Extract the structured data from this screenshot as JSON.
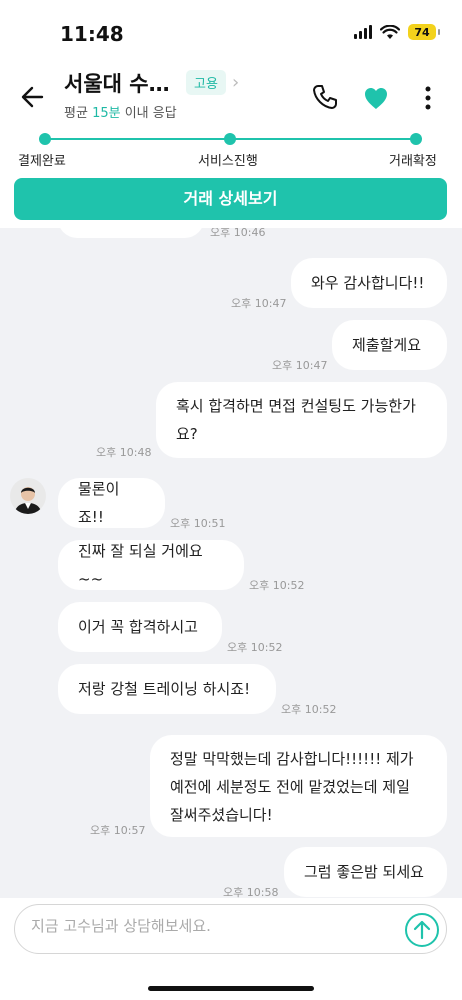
{
  "status_bar": {
    "time": "11:48",
    "battery": "74"
  },
  "header": {
    "title": "서울대 수…",
    "tag": "고용",
    "subtitle_prefix": "평균 ",
    "subtitle_highlight": "15분",
    "subtitle_suffix": " 이내 응답"
  },
  "progress": {
    "steps": [
      "결제완료",
      "서비스진행",
      "거래확정"
    ]
  },
  "detail_button": "거래 상세보기",
  "messages": [
    {
      "side": "right",
      "text": "와우 감사합니다!!",
      "time": "오후 10:47"
    },
    {
      "side": "right",
      "text": "제출할게요",
      "time": "오후 10:47"
    },
    {
      "side": "right",
      "text": "혹시 합격하면 면접 컨설팅도 가능한가\n요?",
      "time": "오후 10:48"
    },
    {
      "side": "left",
      "text": "물론이죠!!",
      "time": "오후 10:51"
    },
    {
      "side": "left",
      "text": "진짜 잘 되실 거에요~~",
      "time": "오후 10:52"
    },
    {
      "side": "left",
      "text": "이거 꼭 합격하시고",
      "time": "오후 10:52"
    },
    {
      "side": "left",
      "text": "저랑 강철 트레이닝 하시죠!",
      "time": "오후 10:52"
    },
    {
      "side": "right",
      "text": "정말 막막했는데 감사합니다!!!!!! 제가\n예전에 세분정도 전에 맡겼었는데 제일\n잘써주셨습니다!",
      "time": "오후 10:57"
    },
    {
      "side": "right",
      "text": "그럼 좋은밤 되세요",
      "time": "오후 10:58"
    }
  ],
  "partial_top_time": "오후 10:46",
  "input": {
    "placeholder": "지금 고수님과 상담해보세요."
  },
  "colors": {
    "accent": "#1fc3ac",
    "chat_bg": "#f1f2f5"
  }
}
